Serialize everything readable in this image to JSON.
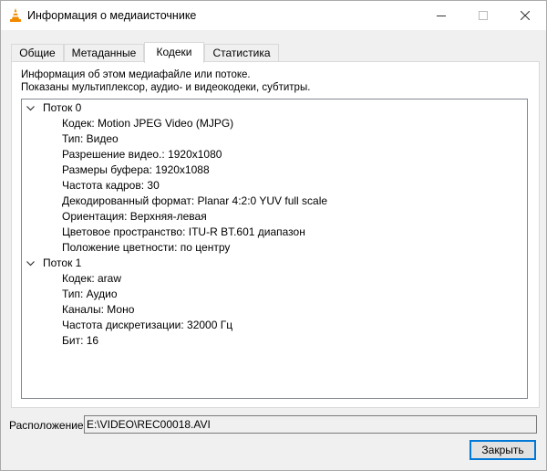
{
  "window": {
    "title": "Информация о медиаисточнике"
  },
  "tabs": [
    {
      "label": "Общие",
      "active": false
    },
    {
      "label": "Метаданные",
      "active": false
    },
    {
      "label": "Кодеки",
      "active": true
    },
    {
      "label": "Статистика",
      "active": false
    }
  ],
  "codecs": {
    "info_line1": "Информация об этом медиафайле или потоке.",
    "info_line2": "Показаны мультиплексор, аудио- и видеокодеки, субтитры.",
    "streams": [
      {
        "title": "Поток 0",
        "expanded": true,
        "props": [
          "Кодек: Motion JPEG Video (MJPG)",
          "Тип: Видео",
          "Разрешение видео.: 1920x1080",
          "Размеры буфера: 1920x1088",
          "Частота кадров: 30",
          "Декодированный формат: Planar 4:2:0 YUV full scale",
          "Ориентация: Верхняя-левая",
          "Цветовое пространство: ITU-R BT.601 диапазон",
          "Положение цветности: по центру"
        ]
      },
      {
        "title": "Поток 1",
        "expanded": true,
        "props": [
          "Кодек: araw",
          "Тип: Аудио",
          "Каналы: Моно",
          "Частота дискретизации: 32000 Гц",
          "Бит: 16"
        ]
      }
    ]
  },
  "location": {
    "label": "Расположение:",
    "value": "E:\\VIDEO\\REC00018.AVI"
  },
  "buttons": {
    "close_label": "Закрыть"
  },
  "icons": {
    "app": "vlc-cone-icon",
    "minimize": "minimize-icon",
    "maximize": "maximize-icon",
    "close": "close-icon",
    "expand": "chevron-down-icon"
  },
  "colors": {
    "accent": "#0078d7",
    "vlc_orange": "#f08a00"
  }
}
